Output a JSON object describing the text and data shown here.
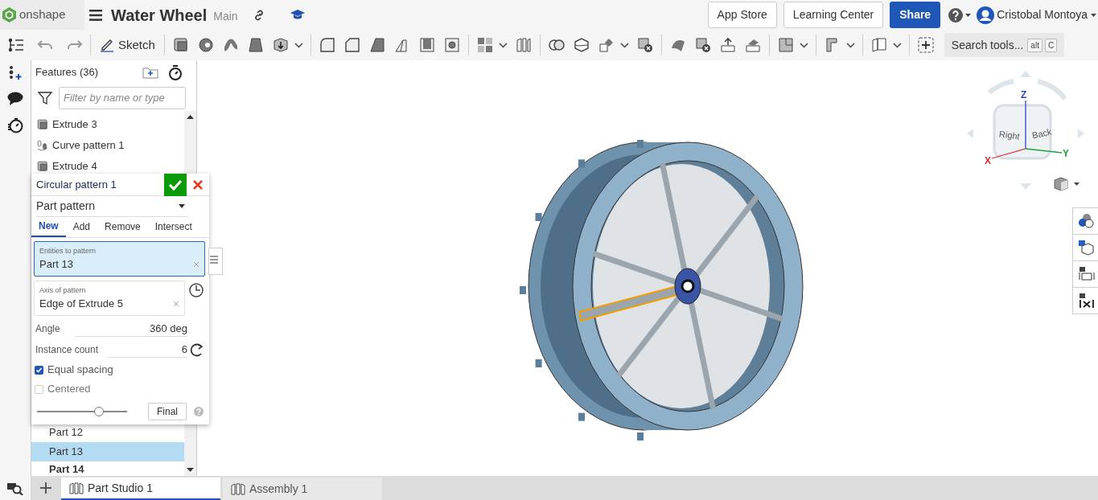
{
  "app": {
    "logo_text": "onshape",
    "document_title": "Water Wheel",
    "branch": "Main"
  },
  "header_buttons": [
    {
      "label": "App Store",
      "kind": "outline"
    },
    {
      "label": "Learning Center",
      "kind": "outline"
    },
    {
      "label": "Share",
      "kind": "primary"
    }
  ],
  "user": {
    "name": "Cristobal Montoya"
  },
  "toolbar": {
    "sketch_label": "Sketch",
    "search_placeholder": "Search tools...",
    "shortcut_keys": [
      "alt",
      "C"
    ]
  },
  "features": {
    "title": "Features (36)",
    "filter_placeholder": "Filter by name or type",
    "items": [
      {
        "label": "Extrude 3",
        "kind": "extrude",
        "selected": false
      },
      {
        "label": "Curve pattern 1",
        "kind": "pattern",
        "selected": false
      },
      {
        "label": "Extrude 4",
        "kind": "extrude",
        "selected": false
      }
    ],
    "parts": [
      {
        "label": "Part 12",
        "selected": false,
        "emphasized": false
      },
      {
        "label": "Part 13",
        "selected": true,
        "emphasized": false
      },
      {
        "label": "Part 14",
        "selected": false,
        "emphasized": true
      }
    ]
  },
  "dialog": {
    "title": "Circular pattern 1",
    "pattern_type": "Part pattern",
    "tabs": [
      {
        "label": "New",
        "selected": true
      },
      {
        "label": "Add",
        "selected": false
      },
      {
        "label": "Remove",
        "selected": false
      },
      {
        "label": "Intersect",
        "selected": false
      }
    ],
    "fields": [
      {
        "label": "Entities to pattern",
        "value": "Part 13",
        "focused": true
      },
      {
        "label": "Axis of pattern",
        "value": "Edge of Extrude 5",
        "focused": false
      }
    ],
    "angle": {
      "label": "Angle",
      "value": "360 deg"
    },
    "instance_count": {
      "label": "Instance count",
      "value": "6"
    },
    "checkboxes": [
      {
        "label": "Equal spacing",
        "checked": true
      },
      {
        "label": "Centered",
        "checked": false
      }
    ],
    "slider": {
      "level": 0.69
    },
    "final_button": "Final"
  },
  "view_cube": {
    "faces": [
      "Right",
      "Back"
    ],
    "axes": [
      {
        "label": "Z",
        "color": "#3344cc"
      },
      {
        "label": "X",
        "color": "#d83030"
      },
      {
        "label": "Y",
        "color": "#22a040"
      }
    ]
  },
  "tabs": [
    {
      "label": "Part Studio 1",
      "selected": true
    },
    {
      "label": "Assembly 1",
      "selected": false
    }
  ]
}
